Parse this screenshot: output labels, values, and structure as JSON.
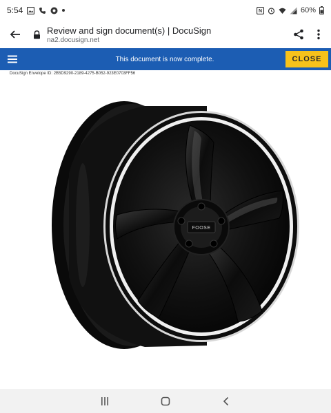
{
  "status_bar": {
    "time": "5:54",
    "battery": "60%",
    "left_icons": [
      "gallery-icon",
      "wifi-call-icon",
      "circle-app-icon",
      "dot-icon"
    ],
    "right_icons": [
      "nfc-icon",
      "alarm-icon",
      "wifi-icon",
      "signal-icon",
      "battery-icon"
    ]
  },
  "browser": {
    "page_title": "Review and sign document(s) | DocuSign",
    "url": "na2.docusign.net",
    "icons": [
      "back-arrow-icon",
      "lock-icon",
      "share-icon",
      "more-vert-icon"
    ]
  },
  "banner": {
    "message": "This document is now complete.",
    "close_label": "CLOSE",
    "colors": {
      "background": "#1c5db3",
      "close_button": "#f7c21b"
    }
  },
  "document": {
    "envelope_id": "DocuSign Envelope ID: 2B5D9290-2189-4275-B052-923E0703FF56",
    "wheel_logo_text": "FOOSE"
  },
  "nav_bar": {
    "icons": [
      "recent-apps-icon",
      "home-icon",
      "back-icon"
    ]
  }
}
